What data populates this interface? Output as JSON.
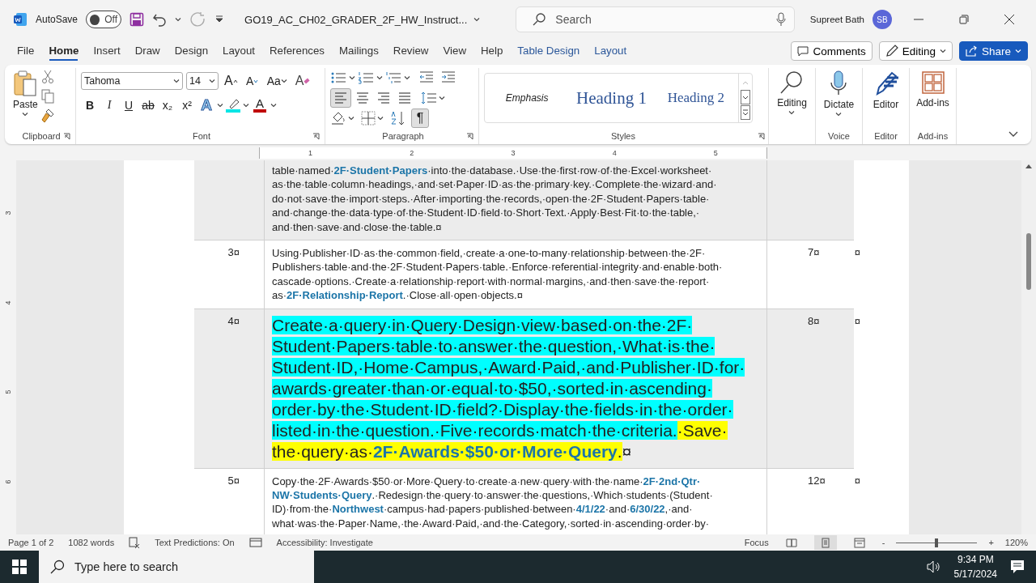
{
  "titlebar": {
    "autosave_label": "AutoSave",
    "autosave": {
      "label": "Off",
      "on": false
    },
    "filename": "GO19_AC_CH02_GRADER_2F_HW_Instruct...",
    "search_placeholder": "Search",
    "user": "Supreet Bath",
    "avatar_initials": "SB"
  },
  "menu_tabs": [
    {
      "label": "File",
      "selected": false,
      "kind": "plain"
    },
    {
      "label": "Home",
      "selected": true,
      "kind": "plain"
    },
    {
      "label": "Insert",
      "selected": false,
      "kind": "plain"
    },
    {
      "label": "Draw",
      "selected": false,
      "kind": "plain"
    },
    {
      "label": "Design",
      "selected": false,
      "kind": "plain"
    },
    {
      "label": "Layout",
      "selected": false,
      "kind": "plain"
    },
    {
      "label": "References",
      "selected": false,
      "kind": "plain"
    },
    {
      "label": "Mailings",
      "selected": false,
      "kind": "plain"
    },
    {
      "label": "Review",
      "selected": false,
      "kind": "plain"
    },
    {
      "label": "View",
      "selected": false,
      "kind": "plain"
    },
    {
      "label": "Help",
      "selected": false,
      "kind": "plain"
    },
    {
      "label": "Table Design",
      "selected": false,
      "kind": "contextual"
    },
    {
      "label": "Layout",
      "selected": false,
      "kind": "contextual"
    }
  ],
  "header_buttons": [
    {
      "label": "Comments",
      "kind": "comments"
    },
    {
      "label": "Editing",
      "kind": "editing"
    },
    {
      "label": "Share",
      "kind": "share"
    }
  ],
  "ribbon": {
    "clipboard": {
      "paste": "Paste",
      "group": "Clipboard"
    },
    "font": {
      "group": "Font",
      "font_name": "Tahoma",
      "font_size": "14",
      "grow": "A",
      "shrink": "A",
      "change_case": "Aa",
      "clear_format": "A",
      "text_effects": "A",
      "highlight": {
        "color": "#00e5e5"
      },
      "font_color": {
        "label": "A",
        "color": "#c00000"
      },
      "format_buttons": [
        {
          "label": "B",
          "kind": "bold"
        },
        {
          "label": "I",
          "kind": "italic"
        },
        {
          "label": "U",
          "kind": "underline"
        },
        {
          "label": "ab",
          "kind": "strike"
        },
        {
          "label": "x₂",
          "kind": "sub"
        },
        {
          "label": "x²",
          "kind": "sup"
        }
      ]
    },
    "paragraph": {
      "group": "Paragraph",
      "align": [
        {
          "kind": "left",
          "selected": true
        },
        {
          "kind": "center",
          "selected": false
        },
        {
          "kind": "right",
          "selected": false
        },
        {
          "kind": "justify",
          "selected": false
        }
      ],
      "show_marks": {
        "label": "¶",
        "on": true
      }
    },
    "styles": {
      "group": "Styles",
      "items": [
        {
          "label": "Emphasis",
          "kind": "emphasis"
        },
        {
          "label": "Heading 1",
          "kind": "heading1"
        },
        {
          "label": "Heading 2",
          "kind": "heading2"
        }
      ]
    },
    "tools": [
      {
        "label": "Editing",
        "kind": "find"
      },
      {
        "label": "Dictate",
        "group": "Voice",
        "kind": "mic"
      },
      {
        "label": "Editor",
        "group": "Editor",
        "kind": "pen"
      },
      {
        "label": "Add-ins",
        "group": "Add-ins",
        "kind": "grid"
      }
    ]
  },
  "ruler": {
    "numbers": [
      "1",
      "2",
      "3",
      "4",
      "5"
    ],
    "vertical_numbers": [
      "3",
      "4",
      "5",
      "6"
    ]
  },
  "table": {
    "rows": [
      {
        "number": "",
        "points": "",
        "end_mark": "",
        "shaded": true,
        "kind": "normal",
        "lines": [
          "table·named·**2F·Student·Papers**·into·the·database.·Use·the·first·row·of·the·Excel·worksheet·",
          "as·the·table·column·headings,·and·set·Paper·ID·as·the·primary·key.·Complete·the·wizard·and·",
          "do·not·save·the·import·steps.·After·importing·the·records,·open·the·2F·Student·Papers·table·",
          "and·change·the·data·type·of·the·Student·ID·field·to·Short·Text.·Apply·Best·Fit·to·the·table,·",
          "and·then·save·and·close·the·table.¤"
        ]
      },
      {
        "number": "3¤",
        "points": "7¤",
        "end_mark": "¤",
        "shaded": false,
        "kind": "normal",
        "lines": [
          "Using·Publisher·ID·as·the·common·field,·create·a·one-to-many·relationship·between·the·2F·",
          "Publishers·table·and·the·2F·Student·Papers·table.·Enforce·referential·integrity·and·enable·both·",
          "cascade·options.·Create·a·relationship·report·with·normal·margins,·and·then·save·the·report·",
          "as·**2F·Relationship·Report**.·Close·all·open·objects.¤"
        ]
      },
      {
        "number": "4¤",
        "points": "8¤",
        "end_mark": "¤",
        "shaded": true,
        "kind": "large",
        "lines": [
          [
            {
              "text": "Create·a·query·in·Query·Design·view·based·on·the·2F·",
              "color": "#00ffff"
            }
          ],
          [
            {
              "text": "Student·Papers·table·to·answer·the·question,·What·is·the·",
              "color": "#00ffff"
            }
          ],
          [
            {
              "text": "Student·ID,·Home·Campus,·Award·Paid,·and·Publisher·ID·for·",
              "color": "#00ffff"
            }
          ],
          [
            {
              "text": "awards·greater·than·or·equal·to·$50,·sorted·in·ascending·",
              "color": "#00ffff"
            }
          ],
          [
            {
              "text": "order·by·the·Student·ID·field?·Display·the·fields·in·the·order·",
              "color": "#00ffff"
            }
          ],
          [
            {
              "text": "listed·in·the·question.·Five·records·match·the·criteria.",
              "color": "#00ffff"
            },
            {
              "text": "·Save·",
              "color": "#ffff00"
            }
          ],
          [
            {
              "text": "the·query·as·**2F·Awards·$50·or·More·Query**.",
              "color": "#ffff00"
            },
            {
              "text": "¤"
            }
          ]
        ]
      },
      {
        "number": "5¤",
        "points": "12¤",
        "end_mark": "¤",
        "shaded": false,
        "kind": "normal",
        "lines": [
          "Copy·the·2F·Awards·$50·or·More·Query·to·create·a·new·query·with·the·name·**2F·2nd·Qtr·**",
          "**NW·Students·Query**.·Redesign·the·query·to·answer·the·questions,·Which·students·(Student·",
          "ID)·from·the·**Northwest**·campus·had·papers·published·between·**4/1/22**·and·**6/30/22**,·and·",
          "what·was·the·Paper·Name,·the·Award·Paid,·and·the·Category,·sorted·in·ascending·order·by·"
        ]
      }
    ]
  },
  "status_bar": {
    "page": "Page 1 of 2",
    "words": "1082 words",
    "predictions": "Text Predictions: On",
    "accessibility": "Accessibility: Investigate",
    "focus": "Focus",
    "views": [
      {
        "kind": "read",
        "selected": false
      },
      {
        "kind": "print",
        "selected": true
      },
      {
        "kind": "web",
        "selected": false
      }
    ],
    "zoom_minus": "-",
    "zoom_plus": "+",
    "zoom": {
      "level": 0.5
    },
    "zoom_value": "120%"
  },
  "taskbar": {
    "search_placeholder": "Type here to search",
    "time": "9:34 PM",
    "date": "5/17/2024"
  }
}
